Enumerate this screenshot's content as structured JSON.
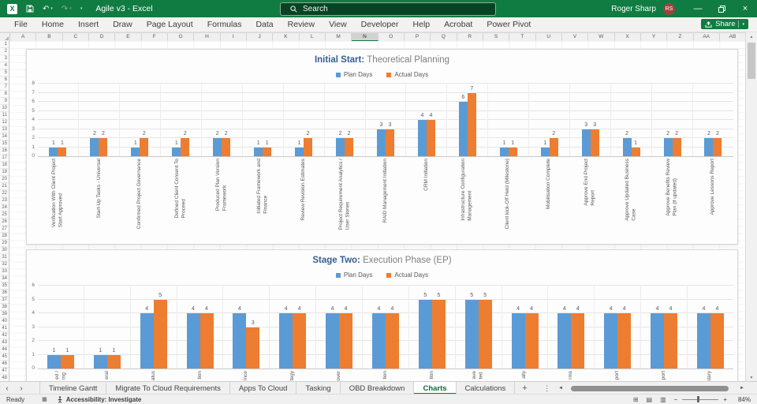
{
  "colors": {
    "titlebar_green": "#107c41",
    "bar_blue": "#5b9bd5",
    "bar_orange": "#ed7d31",
    "chart_title_blue": "#365f91",
    "avatar_red": "#9a453d",
    "active_tab_green": "#107c41"
  },
  "icons": {
    "undo": "↶",
    "redo": "↷",
    "dropdown_caret": "▾",
    "minimize": "—",
    "close": "×",
    "sheet_prev": "‹",
    "sheet_next": "›",
    "sheet_more": "⋮",
    "scroll_left": "◄",
    "scroll_right": "►",
    "scroll_up": "▲",
    "scroll_down": "▼",
    "add_sheet": "+",
    "view_normal": "⊞",
    "view_page_layout": "▤",
    "view_page_break": "▥",
    "macro_record": "▦",
    "zoom_out": "−",
    "zoom_in": "+",
    "select_all_corner": "◢"
  },
  "title_bar": {
    "app_initial": "X",
    "window_title": "Agile v3 - Excel",
    "search_placeholder": "Search",
    "user_name": "Roger Sharp",
    "user_initials": "RS"
  },
  "ribbon": {
    "tabs": [
      "File",
      "Home",
      "Insert",
      "Draw",
      "Page Layout",
      "Formulas",
      "Data",
      "Review",
      "View",
      "Developer",
      "Help",
      "Acrobat",
      "Power Pivot"
    ],
    "share_label": "Share"
  },
  "grid": {
    "columns": [
      "A",
      "B",
      "C",
      "D",
      "E",
      "F",
      "G",
      "H",
      "I",
      "J",
      "K",
      "L",
      "M",
      "N",
      "O",
      "P",
      "Q",
      "R",
      "S",
      "T",
      "U",
      "V",
      "W",
      "X",
      "Y",
      "Z",
      "AA",
      "AB"
    ],
    "selected_column": "N",
    "rows_first": 1,
    "rows_last": 48
  },
  "chart_data": [
    {
      "type": "bar",
      "title": "Initial Start: Theoretical Planning",
      "title_bold": "Initial Start:",
      "title_rest": "Theoretical Planning",
      "legend_position": "top",
      "grid": true,
      "data_labels": true,
      "ylim": [
        0,
        8
      ],
      "ytick_step": 1,
      "colors": [
        "#5b9bd5",
        "#ed7d31"
      ],
      "categories": [
        "Verification With Client Project\nStart Approved",
        "Start-Up Tasks - Universal",
        "Confirmed Project Governance",
        "Defined Client Consent To\nProceed",
        "Produced Plan Version\nFramework",
        "Initiated Framework and\nFinance",
        "Review Revision Estimates",
        "Project Requirement Analytics /\nUser Stories",
        "RAID Management Initiation",
        "CRM Initiation",
        "Infrastructure Configuration\nManagement",
        "Client kick-Off Held (Milestone)",
        "Mobilisation Complete",
        "Approve End Project\nReport",
        "Approve Updated Business\nCase",
        "Approve Benefits Review\nPlan (if updated)",
        "Approve Lessons Report"
      ],
      "series": [
        {
          "name": "Plan Days",
          "values": [
            1,
            2,
            1,
            1,
            2,
            1,
            1,
            2,
            3,
            4,
            6,
            1,
            1,
            3,
            2,
            2,
            2
          ]
        },
        {
          "name": "Actual Days",
          "values": [
            1,
            2,
            2,
            2,
            2,
            1,
            2,
            2,
            3,
            4,
            7,
            1,
            2,
            3,
            1,
            2,
            2
          ]
        }
      ]
    },
    {
      "type": "bar",
      "title": "Stage Two: Execution Phase (EP)",
      "title_bold": "Stage Two:",
      "title_rest": "Execution Phase (EP)",
      "legend_position": "top",
      "grid": true,
      "data_labels": true,
      "ylim": [
        0,
        6
      ],
      "ytick_step": 1,
      "colors": [
        "#5b9bd5",
        "#ed7d31"
      ],
      "categories_visible_fragments": [
        "ed /\ning",
        "eral",
        "atus",
        "tion",
        "ince",
        "tegy",
        "over",
        "tion",
        "tion",
        "ave\nted",
        "ally",
        "rms",
        "port",
        "port",
        "dary"
      ],
      "series": [
        {
          "name": "Plan Days",
          "values": [
            1,
            1,
            4,
            4,
            4,
            4,
            4,
            4,
            5,
            5,
            4,
            4,
            4,
            4,
            4
          ]
        },
        {
          "name": "Actual Days",
          "values": [
            1,
            1,
            5,
            4,
            3,
            4,
            4,
            4,
            5,
            5,
            4,
            4,
            4,
            4,
            4
          ]
        }
      ]
    }
  ],
  "sheet_tabs": {
    "tabs": [
      {
        "label": "Timeline Gantt",
        "active": false
      },
      {
        "label": "Migrate To Cloud Requirements",
        "active": false
      },
      {
        "label": "Apps To Cloud",
        "active": false
      },
      {
        "label": "Tasking",
        "active": false
      },
      {
        "label": "OBD Breakdown",
        "active": false
      },
      {
        "label": "Charts",
        "active": true
      },
      {
        "label": "Calculations",
        "active": false
      }
    ],
    "add_label": "+"
  },
  "status_bar": {
    "ready": "Ready",
    "accessibility": "Accessibility: Investigate",
    "zoom": "84%"
  }
}
